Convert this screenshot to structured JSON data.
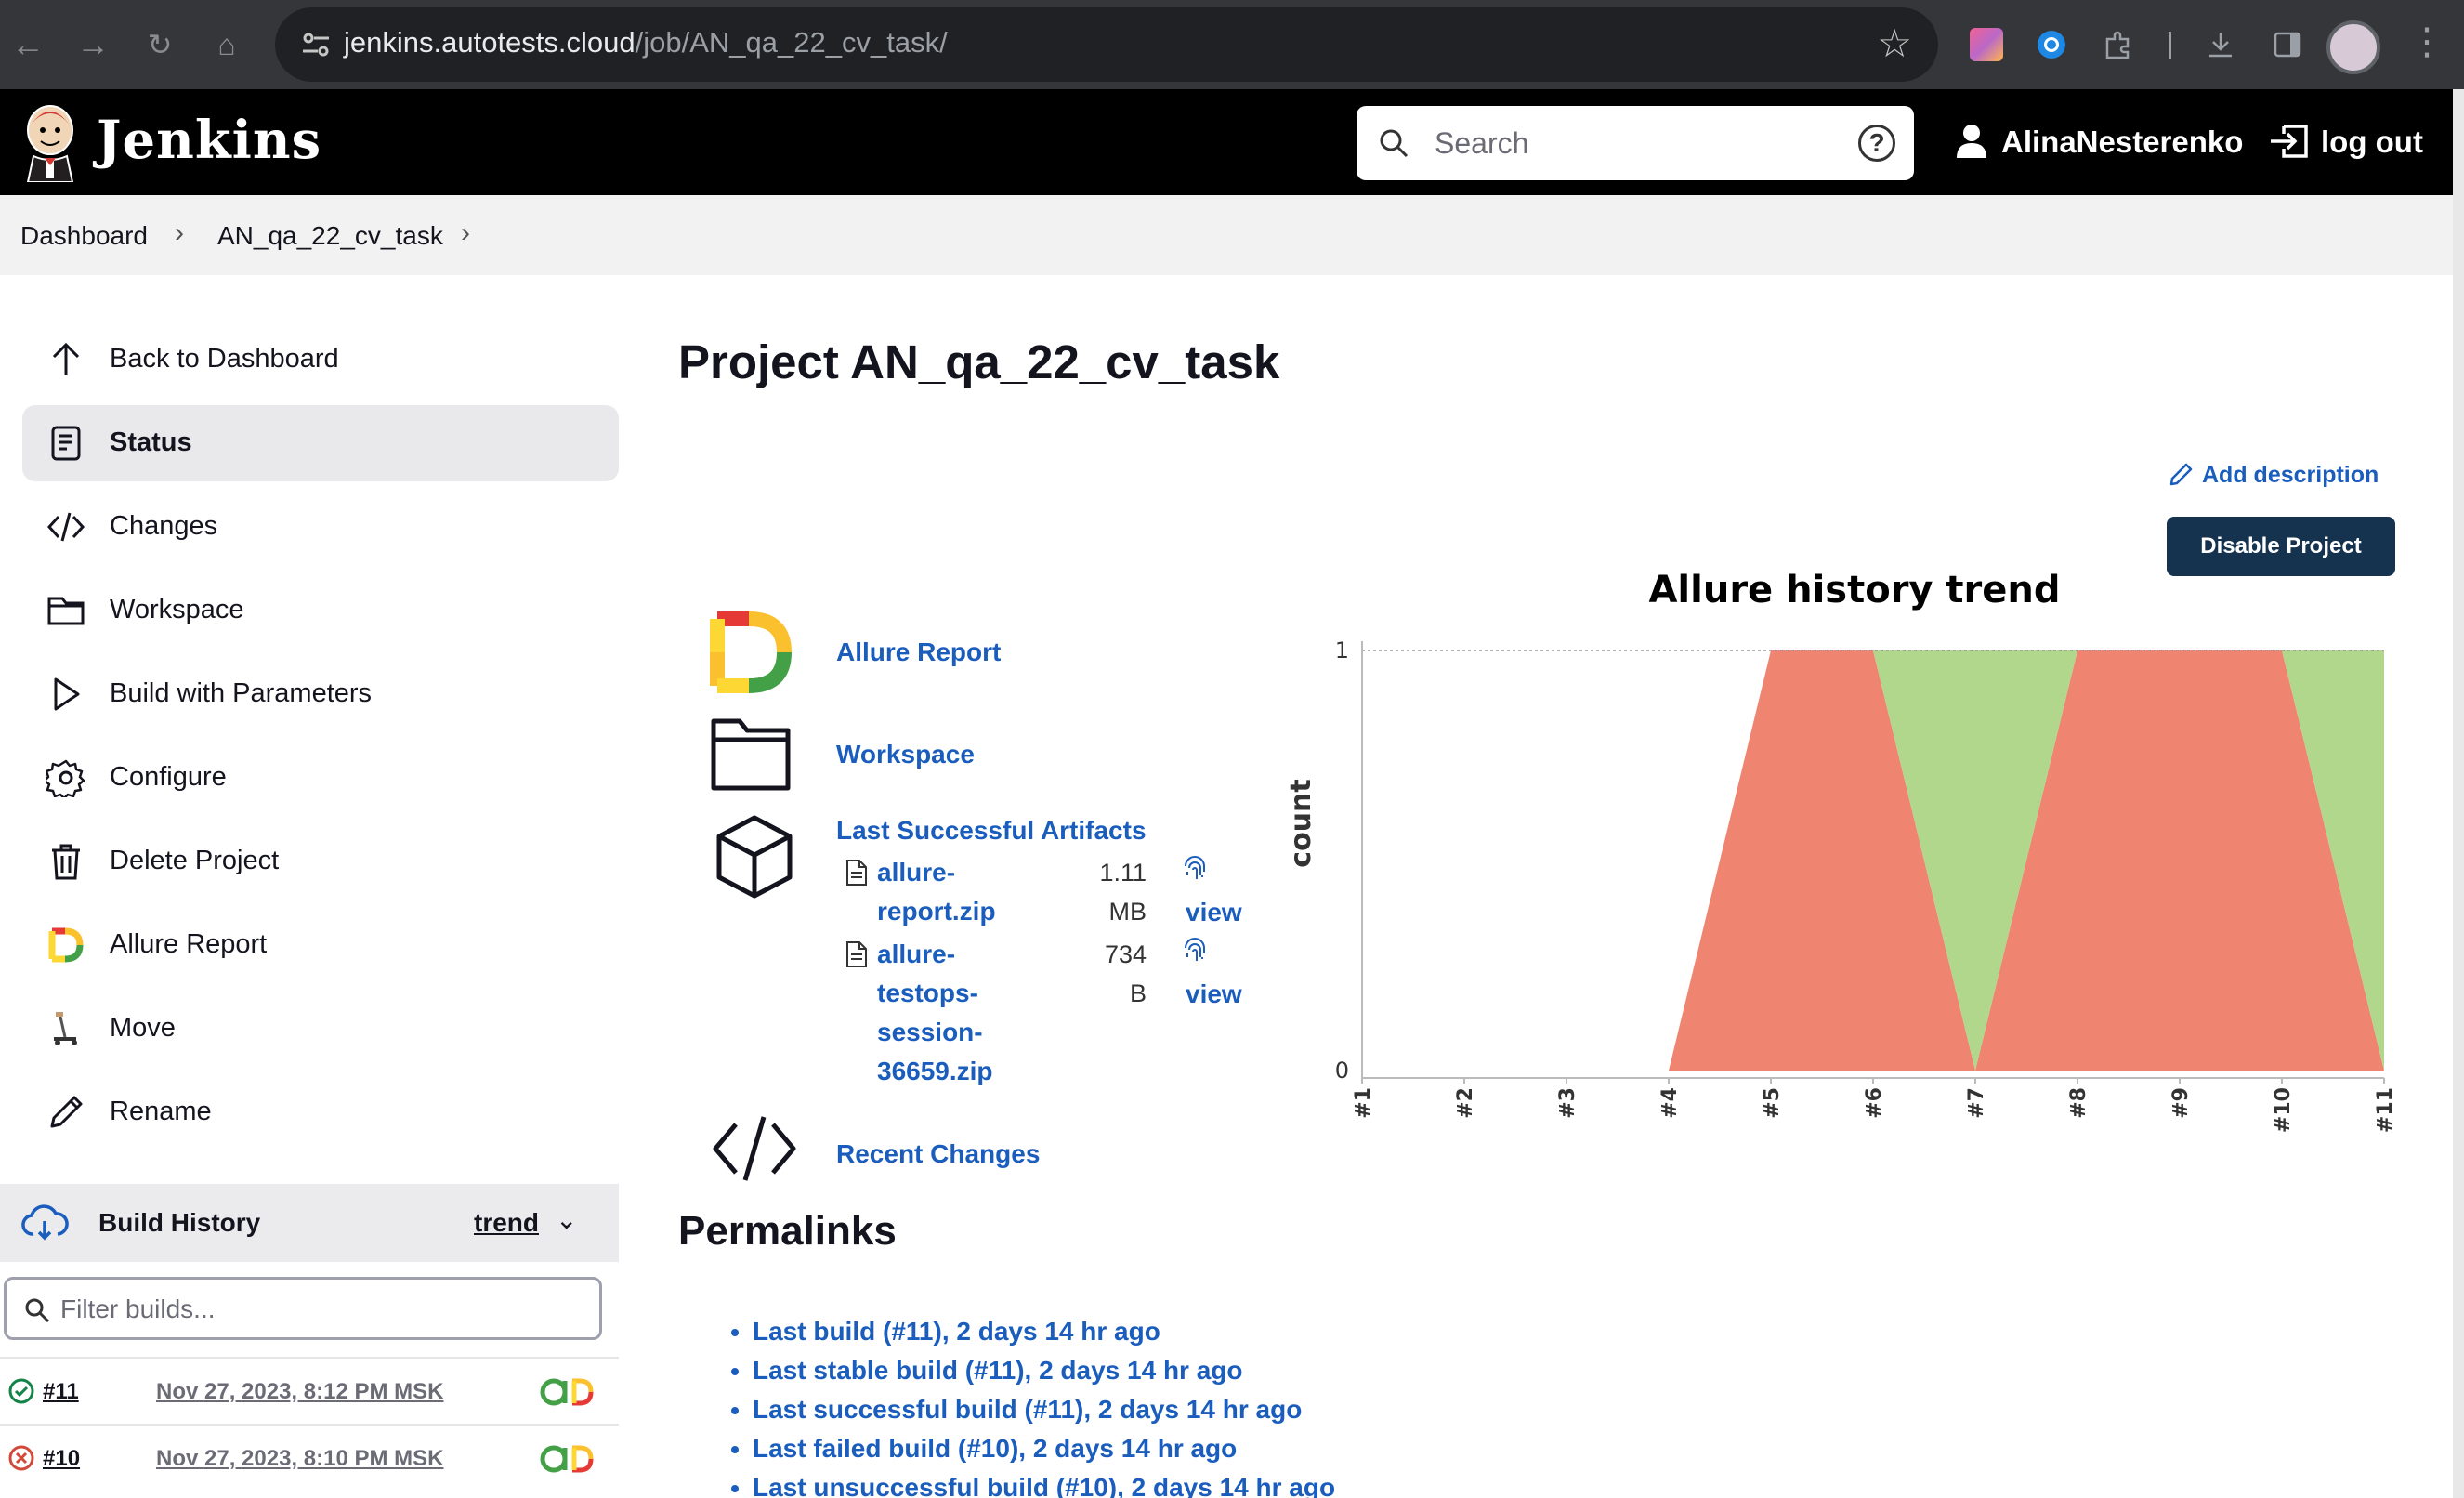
{
  "browser": {
    "url_host": "jenkins.autotests.cloud",
    "url_path": "/job/AN_qa_22_cv_task/"
  },
  "header": {
    "title": "Jenkins",
    "search_placeholder": "Search",
    "help_label": "?",
    "user": "AlinaNesterenko",
    "logout": "log out"
  },
  "breadcrumb": [
    "Dashboard",
    "AN_qa_22_cv_task"
  ],
  "sidebar": {
    "items": [
      {
        "label": "Back to Dashboard",
        "icon": "arrow-up-icon"
      },
      {
        "label": "Status",
        "icon": "document-icon"
      },
      {
        "label": "Changes",
        "icon": "code-icon"
      },
      {
        "label": "Workspace",
        "icon": "folder-icon"
      },
      {
        "label": "Build with Parameters",
        "icon": "play-icon"
      },
      {
        "label": "Configure",
        "icon": "gear-icon"
      },
      {
        "label": "Delete Project",
        "icon": "trash-icon"
      },
      {
        "label": "Allure Report",
        "icon": "allure-icon"
      },
      {
        "label": "Move",
        "icon": "move-icon"
      },
      {
        "label": "Rename",
        "icon": "pencil-icon"
      }
    ]
  },
  "build_history": {
    "title": "Build History",
    "trend": "trend",
    "filter_placeholder": "Filter builds...",
    "builds": [
      {
        "number": "#11",
        "date": "Nov 27, 2023, 8:12 PM MSK",
        "status": "success"
      },
      {
        "number": "#10",
        "date": "Nov 27, 2023, 8:10 PM MSK",
        "status": "failure"
      }
    ]
  },
  "main": {
    "title": "Project AN_qa_22_cv_task",
    "add_description": "Add description",
    "disable_button": "Disable Project",
    "links": {
      "allure_report": "Allure Report",
      "workspace": "Workspace",
      "last_successful_artifacts": "Last Successful Artifacts",
      "recent_changes": "Recent Changes"
    },
    "artifacts": [
      {
        "name_lines": [
          "allure-",
          "report.zip"
        ],
        "size_lines": [
          "1.11",
          "MB"
        ],
        "view": "view"
      },
      {
        "name_lines": [
          "allure-",
          "testops-",
          "session-",
          "36659.zip"
        ],
        "size_lines": [
          "734",
          "B"
        ],
        "view": "view"
      }
    ],
    "permalinks_title": "Permalinks",
    "permalinks": [
      "Last build (#11), 2 days 14 hr ago",
      "Last stable build (#11), 2 days 14 hr ago",
      "Last successful build (#11), 2 days 14 hr ago",
      "Last failed build (#10), 2 days 14 hr ago",
      "Last unsuccessful build (#10), 2 days 14 hr ago"
    ]
  },
  "colors": {
    "link": "#1a5dbd",
    "failed": "#ef8470",
    "passed": "#b1d78c",
    "button": "#15324f"
  },
  "chart_data": {
    "type": "area",
    "title": "Allure history trend",
    "ylabel": "count",
    "xlabel": "",
    "x": [
      "#1",
      "#2",
      "#3",
      "#4",
      "#5",
      "#6",
      "#7",
      "#8",
      "#9",
      "#10",
      "#11"
    ],
    "ylim": [
      0,
      1
    ],
    "yticks": [
      0,
      1
    ],
    "series": [
      {
        "key": "failed",
        "values": [
          0,
          0,
          0,
          0,
          1,
          1,
          0,
          1,
          1,
          1,
          0
        ]
      },
      {
        "key": "passed",
        "values": [
          0,
          0,
          0,
          0,
          0,
          0,
          1,
          0,
          0,
          0,
          1
        ]
      }
    ],
    "stacked": true,
    "grid": false
  }
}
